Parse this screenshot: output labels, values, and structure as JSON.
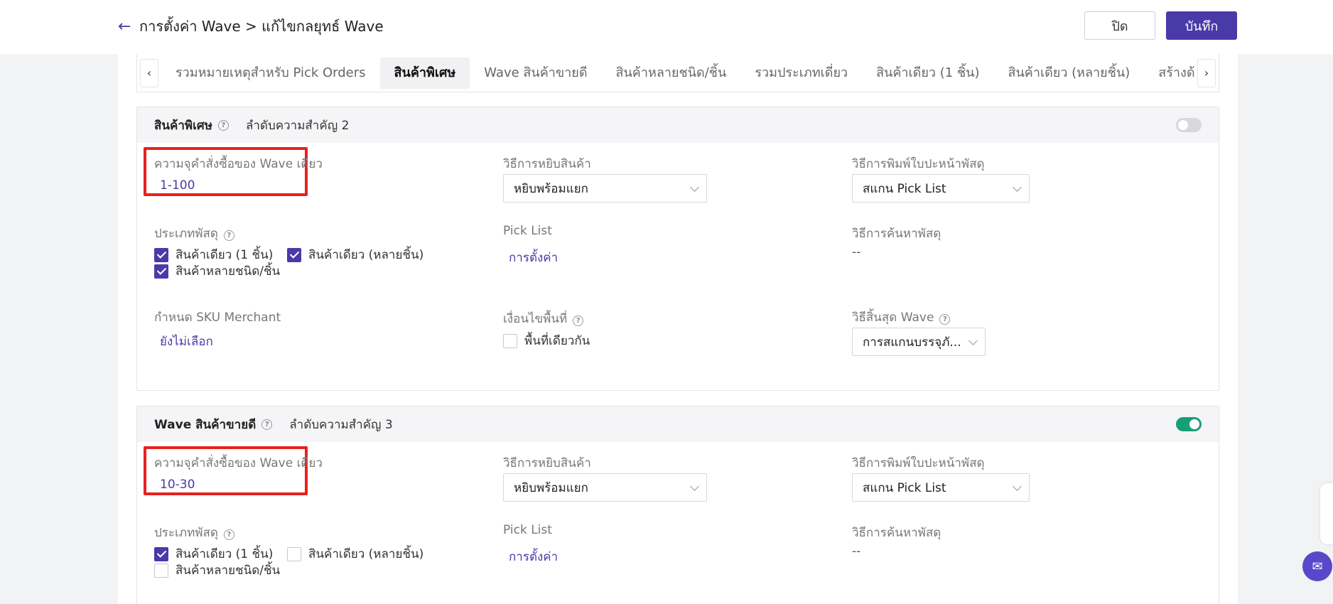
{
  "header": {
    "breadcrumb": "การตั้งค่า Wave > แก้ไขกลยุทธ์ Wave",
    "close_label": "ปิด",
    "save_label": "บันทึก"
  },
  "tabs": [
    {
      "label": "รวมหมายเหตุสำหรับ Pick Orders",
      "active": false
    },
    {
      "label": "สินค้าพิเศษ",
      "active": true
    },
    {
      "label": "Wave สินค้าขายดี",
      "active": false
    },
    {
      "label": "สินค้าหลายชนิด/ชิ้น",
      "active": false
    },
    {
      "label": "รวมประเภทเดี่ยว",
      "active": false
    },
    {
      "label": "สินค้าเดียว (1 ชิ้น)",
      "active": false
    },
    {
      "label": "สินค้าเดียว (หลายชิ้น)",
      "active": false
    },
    {
      "label": "สร้างด้วยตนเอง",
      "active": false
    }
  ],
  "section1": {
    "title": "สินค้าพิเศษ",
    "priority": "ลำดับความสำคัญ 2",
    "enabled": false,
    "order_qty_label": "ความจุคำสั่งซื้อของ Wave เดียว",
    "order_qty_value": "1-100",
    "pick_method_label": "วิธีการหยิบสินค้า",
    "pick_method_value": "หยิบพร้อมแยก",
    "print_method_label": "วิธีการพิมพ์ใบปะหน้าพัสดุ",
    "print_method_value": "สแกน Pick List",
    "parcel_type_label": "ประเภทพัสดุ",
    "parcel_types": [
      {
        "label": "สินค้าเดียว (1 ชิ้น)",
        "checked": true
      },
      {
        "label": "สินค้าเดียว (หลายชิ้น)",
        "checked": true
      },
      {
        "label": "สินค้าหลายชนิด/ชิ้น",
        "checked": true
      }
    ],
    "pick_list_label": "Pick List",
    "pick_list_link": "การตั้งค่า",
    "search_method_label": "วิธีการค้นหาพัสดุ",
    "search_method_value": "--",
    "sku_label": "กำหนด SKU Merchant",
    "sku_value": "ยังไม่เลือก",
    "area_label": "เงื่อนไขพื้นที่",
    "area_option": "พื้นที่เดียวกัน",
    "area_checked": false,
    "end_method_label": "วิธีสิ้นสุด Wave",
    "end_method_value": "การสแกนบรรจุภั..."
  },
  "section2": {
    "title": "Wave สินค้าขายดี",
    "priority": "ลำดับความสำคัญ 3",
    "enabled": true,
    "order_qty_label": "ความจุคำสั่งซื้อของ Wave เดียว",
    "order_qty_value": "10-30",
    "pick_method_label": "วิธีการหยิบสินค้า",
    "pick_method_value": "หยิบพร้อมแยก",
    "print_method_label": "วิธีการพิมพ์ใบปะหน้าพัสดุ",
    "print_method_value": "สแกน Pick List",
    "parcel_type_label": "ประเภทพัสดุ",
    "parcel_types": [
      {
        "label": "สินค้าเดียว (1 ชิ้น)",
        "checked": true
      },
      {
        "label": "สินค้าเดียว (หลายชิ้น)",
        "checked": false
      },
      {
        "label": "สินค้าหลายชนิด/ชิ้น",
        "checked": false
      }
    ],
    "pick_list_label": "Pick List",
    "pick_list_link": "การตั้งค่า",
    "search_method_label": "วิธีการค้นหาพัสดุ",
    "search_method_value": "--"
  },
  "colors": {
    "accent": "#4a3aa8",
    "toggle_on": "#16a076",
    "highlight": "#e8211f"
  },
  "icons": {
    "back": "arrow-left-icon",
    "help": "question-circle-icon",
    "chat": "chat-icon"
  }
}
